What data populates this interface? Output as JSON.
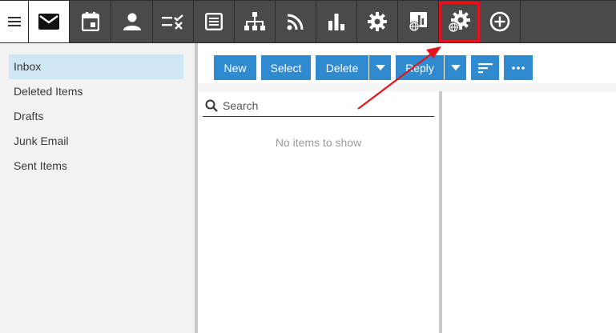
{
  "app_bar": {
    "menu_icon": "hamburger-icon",
    "apps": [
      {
        "name": "Mail",
        "icon": "mail-icon",
        "active": true
      },
      {
        "name": "Calendar",
        "icon": "calendar-icon"
      },
      {
        "name": "People",
        "icon": "person-icon"
      },
      {
        "name": "Tasks",
        "icon": "tasks-icon"
      },
      {
        "name": "Notes",
        "icon": "notes-icon"
      },
      {
        "name": "Org chart",
        "icon": "org-chart-icon"
      },
      {
        "name": "RSS",
        "icon": "rss-icon"
      },
      {
        "name": "Reports",
        "icon": "bar-chart-icon"
      },
      {
        "name": "Settings",
        "icon": "gear-icon"
      },
      {
        "name": "Web reports",
        "icon": "web-report-icon"
      },
      {
        "name": "Web settings",
        "icon": "web-gear-icon",
        "highlighted": true
      },
      {
        "name": "Add",
        "icon": "add-circle-icon"
      }
    ],
    "highlight_color": "#e0141a"
  },
  "folders": [
    {
      "label": "Inbox",
      "selected": true
    },
    {
      "label": "Deleted Items"
    },
    {
      "label": "Drafts"
    },
    {
      "label": "Junk Email"
    },
    {
      "label": "Sent Items"
    }
  ],
  "toolbar": {
    "new_label": "New",
    "select_label": "Select",
    "delete_label": "Delete",
    "reply_label": "Reply",
    "accent": "#2f8ad0"
  },
  "list": {
    "search_placeholder": "Search",
    "empty_text": "No items to show"
  }
}
